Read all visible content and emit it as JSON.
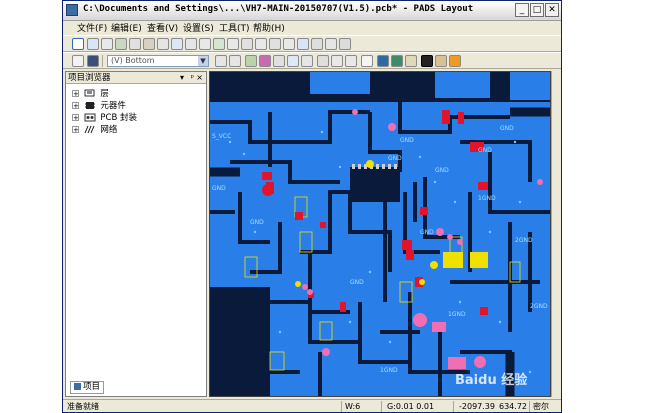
{
  "window": {
    "title": "C:\\Documents and Settings\\...\\VH7-MAIN-20150707(V1.5).pcb* - PADS Layout",
    "controls": {
      "minimize": "_",
      "maximize": "□",
      "close": "✕"
    }
  },
  "menu": {
    "items": [
      "文件(F)",
      "编辑(E)",
      "查看(V)",
      "设置(S)",
      "工具(T)",
      "帮助(H)"
    ]
  },
  "toolbar": {
    "layer_value": "(V) Bottom"
  },
  "project_browser": {
    "title": "项目浏览器",
    "controls": [
      "▾",
      "ᵖ",
      "×"
    ],
    "tree": [
      {
        "label": "层",
        "icon": "layers-icon"
      },
      {
        "label": "元器件",
        "icon": "components-icon"
      },
      {
        "label": "PCB 封装",
        "icon": "pcb-footprint-icon"
      },
      {
        "label": "网络",
        "icon": "nets-icon"
      }
    ],
    "tab": "项目"
  },
  "canvas": {
    "labels": [
      "S_VCC",
      "GND",
      "GND",
      "GND",
      "GND",
      "GND",
      "GND",
      "1GND",
      "GND",
      "GND",
      "2GND",
      "GND",
      "1GND",
      "2GND",
      "1GND"
    ],
    "watermark": "Baidu 经验"
  },
  "statusbar": {
    "ready": "准备就绪",
    "width": "W:6",
    "grid": "G:0.01 0.01",
    "x": "-2097.39",
    "y": "634.72",
    "unit": "密尔"
  },
  "colors": {
    "board": "#2a7ee8",
    "trace": "#0a1a3a",
    "pad_red": "#e0142a",
    "pad_yellow": "#f0e000",
    "pad_pink": "#ef6fb2",
    "label_text": "#9fe0ff"
  }
}
